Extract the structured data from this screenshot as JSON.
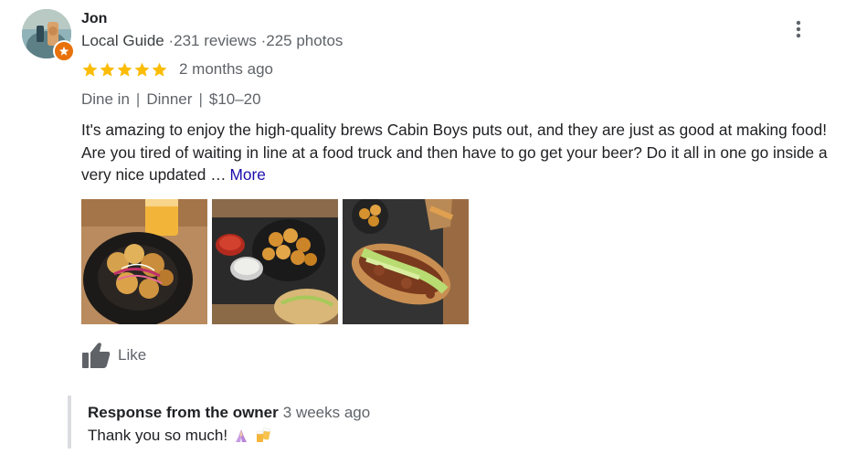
{
  "reviewer": {
    "name": "Jon",
    "level": "Local Guide",
    "reviews": "231 reviews",
    "photos": "225 photos",
    "separator": "·"
  },
  "rating": {
    "stars": 5,
    "max": 5,
    "date": "2 months ago",
    "star_color": "#fbbc04"
  },
  "tags": {
    "service": "Dine in",
    "meal": "Dinner",
    "price": "$10–20",
    "separator": "|"
  },
  "review_text": {
    "body": "It's amazing to enjoy the high-quality brews Cabin Boys puts out, and they are just as good at making food! Are you tired of waiting in line at a food truck and then have to go get your beer? Do it all in one go inside a very nice updated …",
    "more_label": "More"
  },
  "photos": [
    {
      "icon": "photo-wings-and-beer"
    },
    {
      "icon": "photo-tots-and-dips"
    },
    {
      "icon": "photo-sandwich"
    }
  ],
  "actions": {
    "like_label": "Like",
    "like_icon": "thumbs-up-icon",
    "menu_icon": "more-vert-icon"
  },
  "owner_response": {
    "title": "Response from the owner",
    "date": "3 weeks ago",
    "text": "Thank you so much!",
    "emojis": [
      "folded-hands-icon",
      "beer-mugs-icon"
    ]
  },
  "colors": {
    "link": "#1a0dab",
    "secondary_text": "#5f6368",
    "badge": "#e8710a",
    "response_border": "#dadce0"
  }
}
